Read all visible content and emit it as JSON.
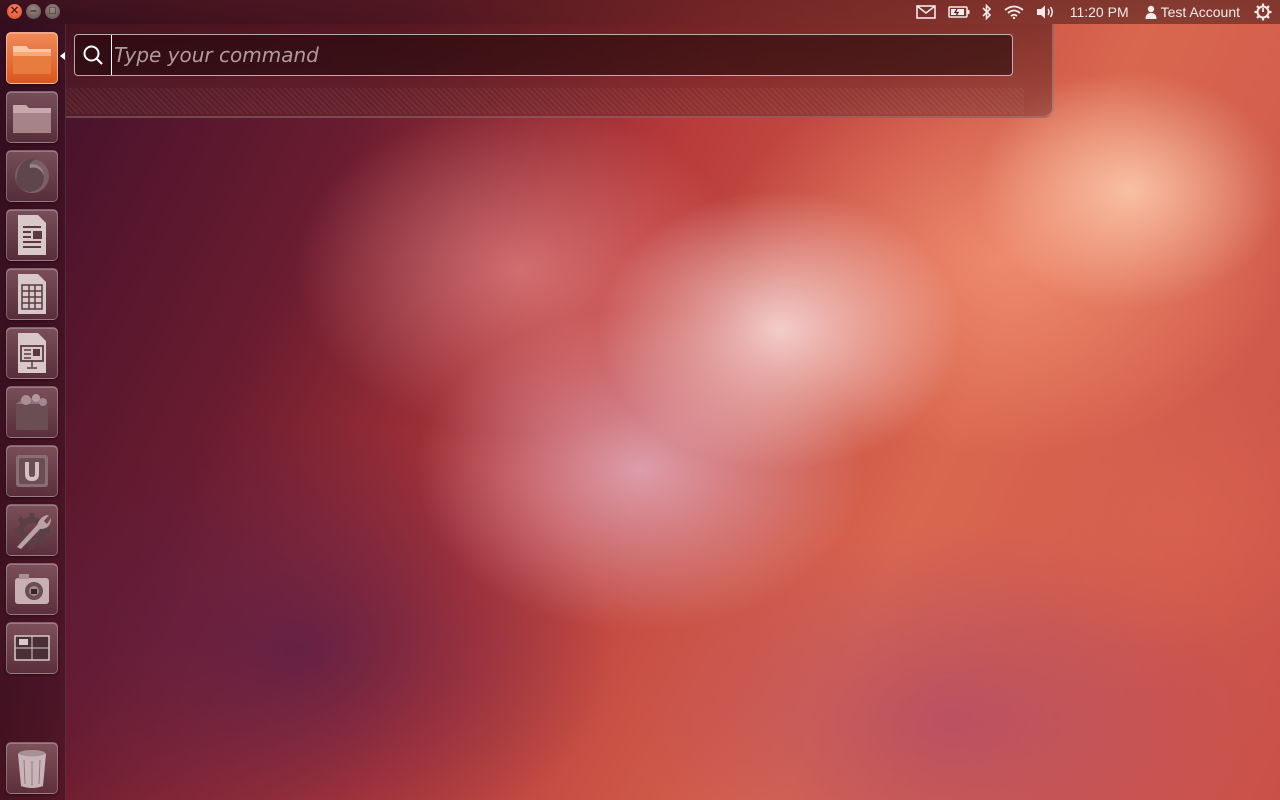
{
  "window_controls": {
    "close_icon": "✕",
    "minimize_icon": "–",
    "maximize_icon": "□"
  },
  "panel": {
    "indicators": [
      "mail-icon",
      "battery-icon",
      "bluetooth-icon",
      "wifi-icon",
      "volume-icon"
    ],
    "clock": "11:20 PM",
    "user": "Test Account",
    "session_icon": "gear-power-icon"
  },
  "launcher": {
    "items": [
      {
        "name": "dash-home",
        "icon": "folder-orange-icon",
        "active": true
      },
      {
        "name": "files",
        "icon": "folder-icon"
      },
      {
        "name": "firefox",
        "icon": "firefox-icon"
      },
      {
        "name": "writer",
        "icon": "document-icon"
      },
      {
        "name": "calc",
        "icon": "spreadsheet-icon"
      },
      {
        "name": "impress",
        "icon": "presentation-icon"
      },
      {
        "name": "software-center",
        "icon": "shopping-bag-icon"
      },
      {
        "name": "ubuntu-one",
        "icon": "ubuntu-one-icon"
      },
      {
        "name": "system-settings",
        "icon": "settings-icon"
      },
      {
        "name": "shotwell",
        "icon": "camera-icon"
      },
      {
        "name": "workspaces",
        "icon": "workspace-switcher-icon"
      },
      {
        "name": "trash",
        "icon": "trash-icon"
      }
    ]
  },
  "hud": {
    "placeholder": "Type your command",
    "value": ""
  },
  "colors": {
    "accent": "#dd5a24",
    "panel_text": "#f0e6e6"
  }
}
